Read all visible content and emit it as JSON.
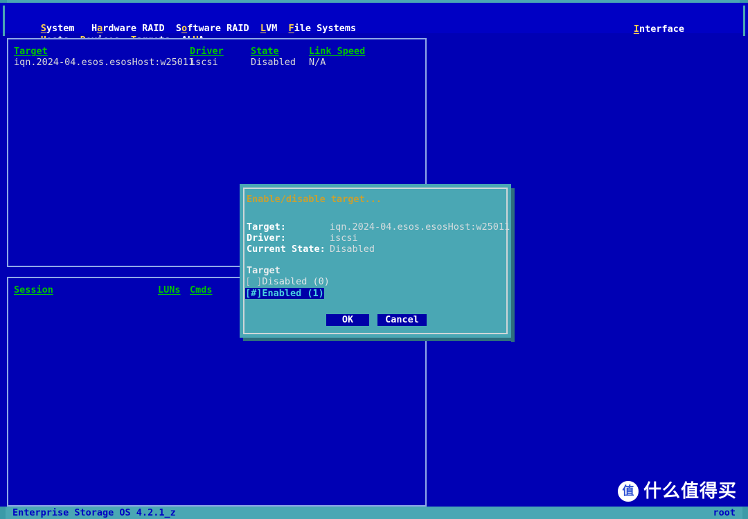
{
  "app": {
    "name": "Enterprise Storage OS",
    "version_line": "Enterprise Storage OS 4.2.1_z",
    "user": "root"
  },
  "menubar": {
    "row1": [
      {
        "label": "System",
        "hotkey": "S",
        "pre": "",
        "post": "ystem"
      },
      {
        "label": "Hardware RAID",
        "hotkey": "a",
        "pre": "H",
        "post": "rdware RAID"
      },
      {
        "label": "Software RAID",
        "hotkey": "o",
        "pre": "S",
        "post": "ftware RAID"
      },
      {
        "label": "LVM",
        "hotkey": "L",
        "pre": "",
        "post": "VM"
      },
      {
        "label": "File Systems",
        "hotkey": "F",
        "pre": "",
        "post": "ile Systems"
      }
    ],
    "row2": [
      {
        "label": "Hosts",
        "hotkey": "H",
        "pre": "",
        "post": "osts"
      },
      {
        "label": "Devices",
        "hotkey": "D",
        "pre": "",
        "post": "evices"
      },
      {
        "label": "Targets",
        "hotkey": "T",
        "pre": "",
        "post": "argets"
      },
      {
        "label": "ALUA",
        "hotkey": "U",
        "pre": "AL",
        "post": "A"
      }
    ],
    "right": {
      "label": "Interface",
      "hotkey": "I",
      "pre": "",
      "post": "nterface"
    }
  },
  "target_panel": {
    "headers": [
      "Target",
      "Driver",
      "State",
      "Link Speed"
    ],
    "rows": [
      {
        "target": "iqn.2024-04.esos.esosHost:w25011",
        "driver": "iscsi",
        "state": "Disabled",
        "link_speed": "N/A"
      }
    ]
  },
  "session_panel": {
    "headers": [
      "Session",
      "LUNs",
      "Cmds"
    ],
    "rows": []
  },
  "dialog": {
    "title": "Enable/disable target...",
    "fields": [
      {
        "label": "Target:",
        "value": "iqn.2024-04.esos.esosHost:w25011"
      },
      {
        "label": "Driver:",
        "value": "iscsi"
      },
      {
        "label": "Current State:",
        "value": "Disabled"
      }
    ],
    "group_label": "Target",
    "options": [
      {
        "mark": "[ ]",
        "label": "Disabled (0)",
        "selected": false
      },
      {
        "mark": "[#]",
        "label": "Enabled (1)",
        "selected": true
      }
    ],
    "buttons": {
      "ok": "OK",
      "cancel": "Cancel"
    }
  },
  "watermark": {
    "badge": "值",
    "text": "什么值得买"
  },
  "colors": {
    "screen_bg": "#0000b4",
    "menu_bg": "#0000c4",
    "hotkey": "#ffd24d",
    "column_header": "#00c400",
    "panel_border": "#8fa8e8",
    "dialog_bg": "#4aa7b4",
    "dialog_title": "#c8a032",
    "selection_bg": "#0000a8",
    "selection_fg": "#4ad0e0",
    "status_bg": "#4aa7b4",
    "status_fg": "#0000c4"
  }
}
